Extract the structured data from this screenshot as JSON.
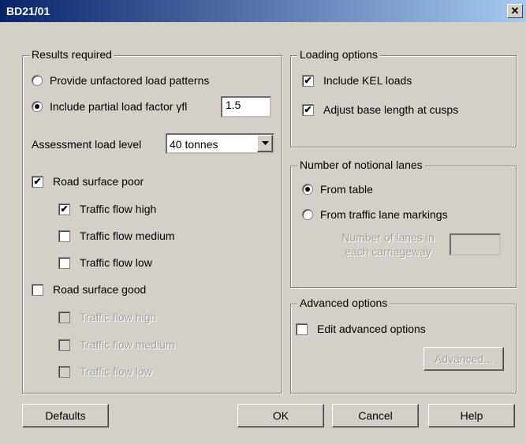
{
  "title": "BD21/01",
  "close_glyph": "✕",
  "results": {
    "legend": "Results required",
    "opt_unfactored": "Provide unfactored load patterns",
    "opt_partial": "Include partial load factor γfl",
    "partial_value": "1.5",
    "assessment_label": "Assessment load level",
    "assessment_value": "40 tonnes",
    "road_poor": "Road surface poor",
    "road_good": "Road surface good",
    "flow_high": "Traffic flow high",
    "flow_medium": "Traffic flow medium",
    "flow_low": "Traffic flow low"
  },
  "loading": {
    "legend": "Loading options",
    "kel": "Include KEL loads",
    "cusps": "Adjust base length at cusps"
  },
  "lanes": {
    "legend": "Number of notional lanes",
    "from_table": "From table",
    "from_markings": "From traffic lane markings",
    "lanes_label_1": "Number of lanes in",
    "lanes_label_2": "each carriageway",
    "lanes_value": ""
  },
  "advanced": {
    "legend": "Advanced options",
    "edit": "Edit advanced options",
    "button": "Advanced..."
  },
  "buttons": {
    "defaults": "Defaults",
    "ok": "OK",
    "cancel": "Cancel",
    "help": "Help"
  }
}
